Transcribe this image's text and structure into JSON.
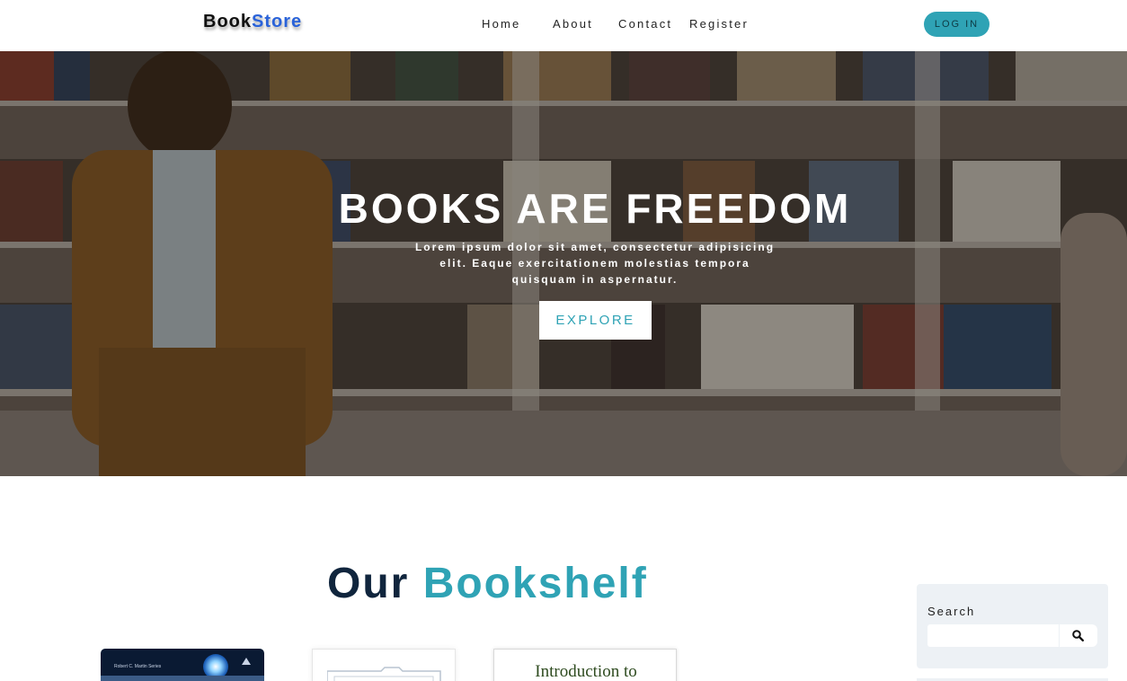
{
  "nav": {
    "brand_part1": "Book",
    "brand_part2": "Store",
    "links": [
      "Home",
      "About",
      "Contact",
      "Register"
    ],
    "login_label": "LOG IN"
  },
  "hero": {
    "title": "BOOKS ARE FREEDOM",
    "subtitle": "Lorem ipsum dolor sit amet, consectetur adipisicing elit. Eaque exercitationem molestias tempora quisquam in aspernatur.",
    "button_label": "EXPLORE"
  },
  "bookshelf": {
    "title_part1": "Our",
    "title_part2": "Bookshelf",
    "books": [
      {
        "series_text": "Robert C. Martin Series"
      },
      {
        "cover_text": ""
      },
      {
        "cover_title": "Introduction to"
      }
    ]
  },
  "search": {
    "label": "Search",
    "placeholder": "",
    "icon": "search-icon"
  },
  "colors": {
    "accent": "#2fa3b5",
    "brand_blue": "#2962d9",
    "dark_navy": "#10253d",
    "panel_bg": "#edf1f5"
  }
}
